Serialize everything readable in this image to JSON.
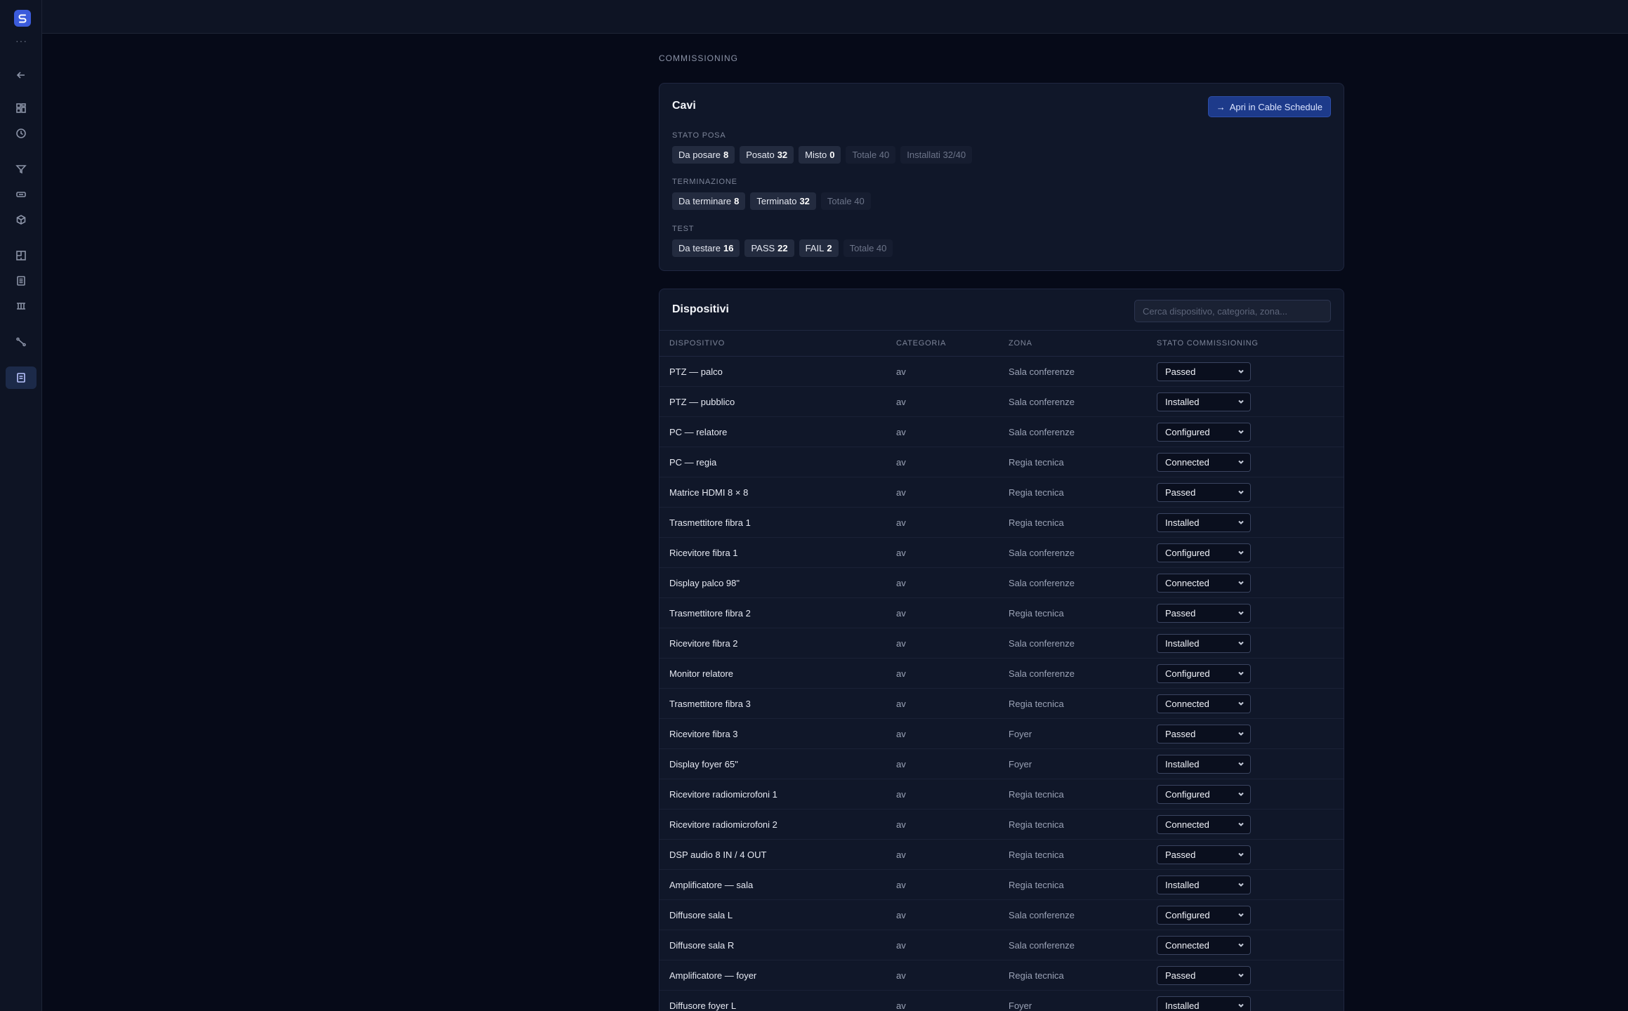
{
  "sidebar": {
    "logo_letter": "S",
    "more": "···",
    "icons": [
      "back-arrow-icon",
      "dashboard-icon",
      "clock-icon",
      "filter-funnel-icon",
      "ticket-icon",
      "cube-icon",
      "floorplan-icon",
      "list-doc-icon",
      "rack-icon",
      "cable-icon",
      "commissioning-icon"
    ]
  },
  "page": {
    "section_title": "COMMISSIONING"
  },
  "cavi": {
    "title": "Cavi",
    "open_button": "Apri in Cable Schedule",
    "stato_posa": {
      "label": "STATO POSA",
      "chips": [
        {
          "text": "Da posare",
          "value": "8"
        },
        {
          "text": "Posato",
          "value": "32"
        },
        {
          "text": "Misto",
          "value": "0"
        },
        {
          "text": "Totale 40",
          "value": ""
        },
        {
          "text": "Installati 32/40",
          "value": ""
        }
      ]
    },
    "terminazione": {
      "label": "TERMINAZIONE",
      "chips": [
        {
          "text": "Da terminare",
          "value": "8"
        },
        {
          "text": "Terminato",
          "value": "32"
        },
        {
          "text": "Totale 40",
          "value": ""
        }
      ]
    },
    "test": {
      "label": "TEST",
      "chips": [
        {
          "text": "Da testare",
          "value": "16"
        },
        {
          "text": "PASS",
          "value": "22"
        },
        {
          "text": "FAIL",
          "value": "2"
        },
        {
          "text": "Totale 40",
          "value": ""
        }
      ]
    }
  },
  "dispositivi": {
    "title": "Dispositivi",
    "search_placeholder": "Cerca dispositivo, categoria, zona...",
    "columns": [
      "DISPOSITIVO",
      "CATEGORIA",
      "ZONA",
      "STATO COMMISSIONING"
    ],
    "rows": [
      {
        "name": "PTZ — palco",
        "cat": "av",
        "zone": "Sala conferenze",
        "status": "Passed"
      },
      {
        "name": "PTZ — pubblico",
        "cat": "av",
        "zone": "Sala conferenze",
        "status": "Installed"
      },
      {
        "name": "PC — relatore",
        "cat": "av",
        "zone": "Sala conferenze",
        "status": "Configured"
      },
      {
        "name": "PC — regia",
        "cat": "av",
        "zone": "Regia tecnica",
        "status": "Connected"
      },
      {
        "name": "Matrice HDMI 8 × 8",
        "cat": "av",
        "zone": "Regia tecnica",
        "status": "Passed"
      },
      {
        "name": "Trasmettitore fibra 1",
        "cat": "av",
        "zone": "Regia tecnica",
        "status": "Installed"
      },
      {
        "name": "Ricevitore fibra 1",
        "cat": "av",
        "zone": "Sala conferenze",
        "status": "Configured"
      },
      {
        "name": "Display palco 98\"",
        "cat": "av",
        "zone": "Sala conferenze",
        "status": "Connected"
      },
      {
        "name": "Trasmettitore fibra 2",
        "cat": "av",
        "zone": "Regia tecnica",
        "status": "Passed"
      },
      {
        "name": "Ricevitore fibra 2",
        "cat": "av",
        "zone": "Sala conferenze",
        "status": "Installed"
      },
      {
        "name": "Monitor relatore",
        "cat": "av",
        "zone": "Sala conferenze",
        "status": "Configured"
      },
      {
        "name": "Trasmettitore fibra 3",
        "cat": "av",
        "zone": "Regia tecnica",
        "status": "Connected"
      },
      {
        "name": "Ricevitore fibra 3",
        "cat": "av",
        "zone": "Foyer",
        "status": "Passed"
      },
      {
        "name": "Display foyer 65\"",
        "cat": "av",
        "zone": "Foyer",
        "status": "Installed"
      },
      {
        "name": "Ricevitore radiomicrofoni 1",
        "cat": "av",
        "zone": "Regia tecnica",
        "status": "Configured"
      },
      {
        "name": "Ricevitore radiomicrofoni 2",
        "cat": "av",
        "zone": "Regia tecnica",
        "status": "Connected"
      },
      {
        "name": "DSP audio 8 IN / 4 OUT",
        "cat": "av",
        "zone": "Regia tecnica",
        "status": "Passed"
      },
      {
        "name": "Amplificatore — sala",
        "cat": "av",
        "zone": "Regia tecnica",
        "status": "Installed"
      },
      {
        "name": "Diffusore sala L",
        "cat": "av",
        "zone": "Sala conferenze",
        "status": "Configured"
      },
      {
        "name": "Diffusore sala R",
        "cat": "av",
        "zone": "Sala conferenze",
        "status": "Connected"
      },
      {
        "name": "Amplificatore — foyer",
        "cat": "av",
        "zone": "Regia tecnica",
        "status": "Passed"
      },
      {
        "name": "Diffusore foyer L",
        "cat": "av",
        "zone": "Foyer",
        "status": "Installed"
      }
    ]
  }
}
